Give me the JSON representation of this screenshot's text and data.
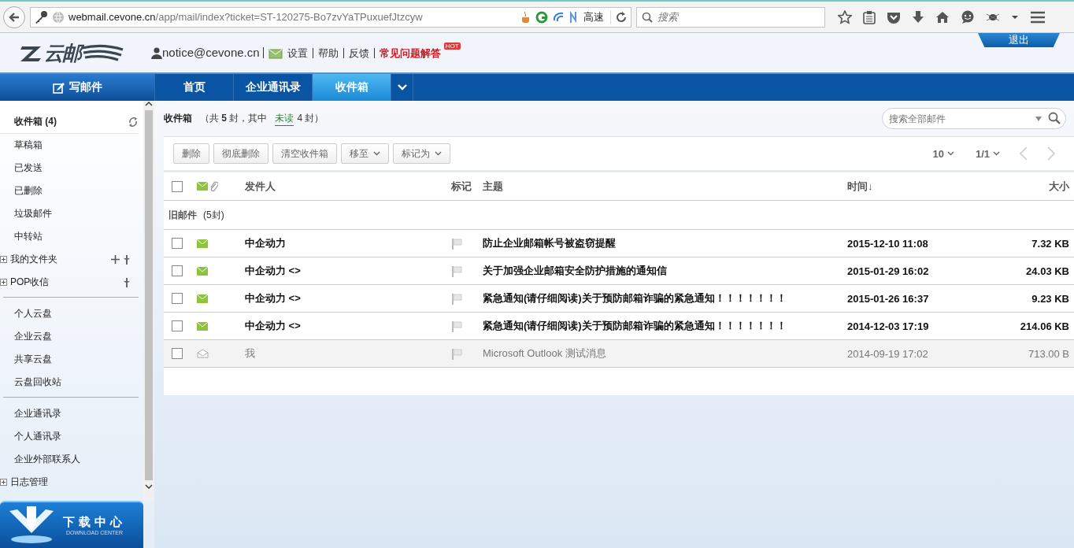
{
  "browser": {
    "url_host": "webmail.cevone.cn",
    "url_path": "/app/mail/index?ticket=ST-120275-Bo7zvYaTPuxuefJtzcyw",
    "speed_label": "高速",
    "search_placeholder": "搜索"
  },
  "header": {
    "logo_text": "云邮",
    "user": "notice@cevone.cn",
    "links": [
      {
        "label": "设置",
        "kind": "normal"
      },
      {
        "label": "帮助",
        "kind": "normal"
      },
      {
        "label": "反馈",
        "kind": "normal"
      },
      {
        "label": "常见问题解答",
        "kind": "highlight"
      }
    ],
    "hot_badge": "HOT",
    "logout": "退出"
  },
  "nav": {
    "compose": "写邮件",
    "tabs": [
      {
        "label": "首页",
        "selected": false
      },
      {
        "label": "企业通讯录",
        "selected": false
      },
      {
        "label": "收件箱",
        "selected": true
      }
    ]
  },
  "sidebar": {
    "sections": [
      {
        "items": [
          {
            "label": "收件箱 (4)",
            "kind": "inbox",
            "selected": true
          },
          {
            "label": "草稿箱",
            "kind": "folder",
            "selected": false
          },
          {
            "label": "已发送",
            "kind": "folder",
            "selected": false
          },
          {
            "label": "已删除",
            "kind": "folder",
            "selected": false
          },
          {
            "label": "垃圾邮件",
            "kind": "folder",
            "selected": false
          },
          {
            "label": "中转站",
            "kind": "folder",
            "selected": false
          },
          {
            "label": "我的文件夹",
            "kind": "group",
            "addable": true,
            "selected": false
          },
          {
            "label": "POP收信",
            "kind": "group",
            "addable": false,
            "selected": false
          }
        ]
      },
      {
        "items": [
          {
            "label": "个人云盘",
            "kind": "folder",
            "selected": false
          },
          {
            "label": "企业云盘",
            "kind": "folder",
            "selected": false
          },
          {
            "label": "共享云盘",
            "kind": "folder",
            "selected": false
          },
          {
            "label": "云盘回收站",
            "kind": "folder",
            "selected": false
          }
        ]
      },
      {
        "items": [
          {
            "label": "企业通讯录",
            "kind": "folder",
            "selected": false
          },
          {
            "label": "个人通讯录",
            "kind": "folder",
            "selected": false
          },
          {
            "label": "企业外部联系人",
            "kind": "folder",
            "selected": false
          },
          {
            "label": "日志管理",
            "kind": "group_plain",
            "selected": false
          }
        ]
      }
    ]
  },
  "download": {
    "title": "下载中心",
    "subtitle": "DOWNLOAD CENTER"
  },
  "main": {
    "title": "收件箱",
    "summary": "（共 **5** 封，其中",
    "unread_link": "未读",
    "summary_end": "4 封）",
    "search_placeholder": "搜索全部邮件",
    "actions": [
      {
        "label": "删除",
        "kind": "button"
      },
      {
        "label": "彻底删除",
        "kind": "button"
      },
      {
        "label": "清空收件箱",
        "kind": "button"
      },
      {
        "label": "移至",
        "kind": "menu"
      },
      {
        "label": "标记为",
        "kind": "menu"
      }
    ],
    "page_size": "10",
    "page": "1/1",
    "select_all_checked": false,
    "columns": {
      "sender": "发件人",
      "flag": "标记",
      "subject": "主题",
      "time": "时间↓",
      "size": "大小"
    },
    "group": {
      "label": "旧邮件",
      "count": "(5封)"
    },
    "rows": [
      {
        "sender": "中企动力",
        "subject": "防止企业邮箱帐号被盗窃提醒",
        "time": "2015-12-10 11:08",
        "size": "7.32 KB",
        "unread": true,
        "checked": false
      },
      {
        "sender": "中企动力 <>",
        "subject": "关于加强企业邮箱安全防护措施的通知信",
        "time": "2015-01-29 16:02",
        "size": "24.03 KB",
        "unread": true,
        "checked": false
      },
      {
        "sender": "中企动力 <>",
        "subject": "紧急通知(请仔细阅读)关于预防邮箱诈骗的紧急通知！！！！！！！",
        "time": "2015-01-26 16:37",
        "size": "9.23 KB",
        "unread": true,
        "checked": false
      },
      {
        "sender": "中企动力 <>",
        "subject": "紧急通知(请仔细阅读)关于预防邮箱诈骗的紧急通知！！！！！！！",
        "time": "2014-12-03 17:19",
        "size": "214.06 KB",
        "unread": true,
        "checked": false
      },
      {
        "sender": "我",
        "subject": "Microsoft Outlook 测试消息",
        "time": "2014-09-19 17:02",
        "size": "713.00 B",
        "unread": false,
        "checked": false
      }
    ]
  }
}
